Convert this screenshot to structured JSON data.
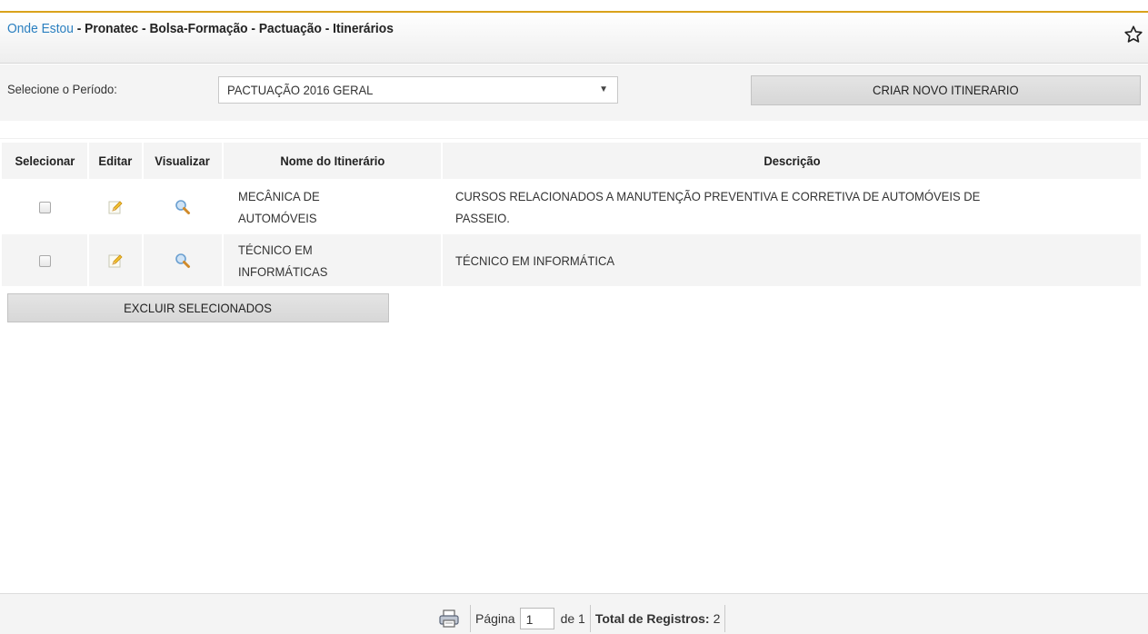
{
  "breadcrumb": {
    "link": "Onde Estou",
    "path": " - Pronatec - Bolsa-Formação - Pactuação - Itinerários"
  },
  "icons": {
    "favorite": "star-outline-icon",
    "edit": "pencil-edit-icon",
    "view": "magnifier-icon",
    "print": "printer-icon"
  },
  "colors": {
    "accent_line": "#d9a21b",
    "link": "#2a7fc0"
  },
  "filter": {
    "label": "Selecione o Período:",
    "selected": "PACTUAÇÃO 2016 GERAL",
    "arrow": "▼",
    "create_button": "CRIAR NOVO ITINERARIO"
  },
  "table": {
    "headers": {
      "select": "Selecionar",
      "edit": "Editar",
      "view": "Visualizar",
      "name": "Nome do Itinerário",
      "description": "Descrição"
    },
    "rows": [
      {
        "name_line1": "MECÂNICA DE",
        "name_line2": "AUTOMÓVEIS",
        "desc_line1": "CURSOS RELACIONADOS A MANUTENÇÃO PREVENTIVA E CORRETIVA DE AUTOMÓVEIS DE",
        "desc_line2": "PASSEIO."
      },
      {
        "name_line1": "TÉCNICO EM",
        "name_line2": "INFORMÁTICAS",
        "desc_line1": "TÉCNICO EM INFORMÁTICA",
        "desc_line2": ""
      }
    ],
    "delete_button": "EXCLUIR SELECIONADOS"
  },
  "pager": {
    "page_label": "Página",
    "page_value": "1",
    "of_label": "de 1",
    "total_label": "Total de Registros:",
    "total_value": "2"
  }
}
